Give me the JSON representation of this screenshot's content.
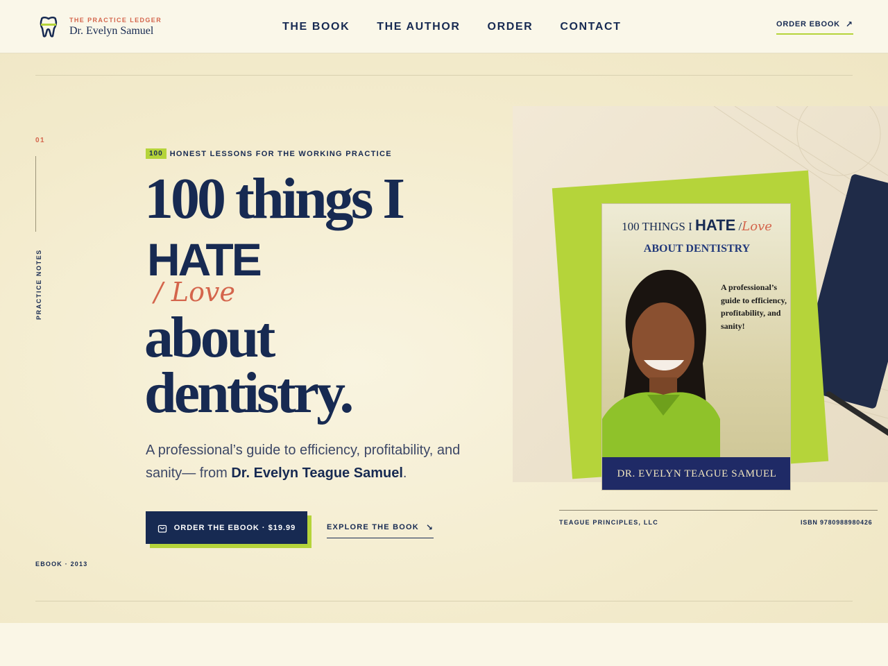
{
  "brand": {
    "eyebrow": "THE PRACTICE LEDGER",
    "name": "Dr. Evelyn Samuel",
    "icon": "tooth-icon"
  },
  "nav": {
    "items": [
      "THE BOOK",
      "THE AUTHOR",
      "ORDER",
      "CONTACT"
    ]
  },
  "header_cta": {
    "label": "ORDER EBOOK",
    "icon": "arrow-up-right-icon"
  },
  "side": {
    "number": "01",
    "label": "PRACTICE NOTES",
    "footer": "EBOOK · 2013"
  },
  "hero": {
    "kicker_badge": "100",
    "kicker_text": "HONEST LESSONS FOR THE WORKING PRACTICE",
    "headline_line1": "100 things I",
    "headline_hate": "HATE",
    "headline_love": "/ Love",
    "headline_line3": "about",
    "headline_line4": "dentistry.",
    "lede_text": "A professional’s guide to efficiency, profitability, and sanity— from ",
    "lede_author": "Dr. Evelyn Teague Samuel",
    "lede_end": ".",
    "primary_cta": "ORDER THE EBOOK · $19.99",
    "secondary_cta": "EXPLORE THE BOOK"
  },
  "book_cover": {
    "title_a": "100 THINGS I ",
    "title_hate": "HATE",
    "title_slash": " /",
    "title_love": "Love",
    "title_line2": "ABOUT DENTISTRY",
    "tagline": "A professional’s guide to efficiency, profitability, and sanity!",
    "author": "DR. EVELYN TEAGUE SAMUEL"
  },
  "art_caption": {
    "publisher": "TEAGUE PRINCIPLES, LLC",
    "isbn": "ISBN 9780988980426"
  },
  "colors": {
    "navy": "#172a52",
    "lime": "#b5d43a",
    "coral": "#d4654c",
    "cream": "#faf6e6"
  }
}
